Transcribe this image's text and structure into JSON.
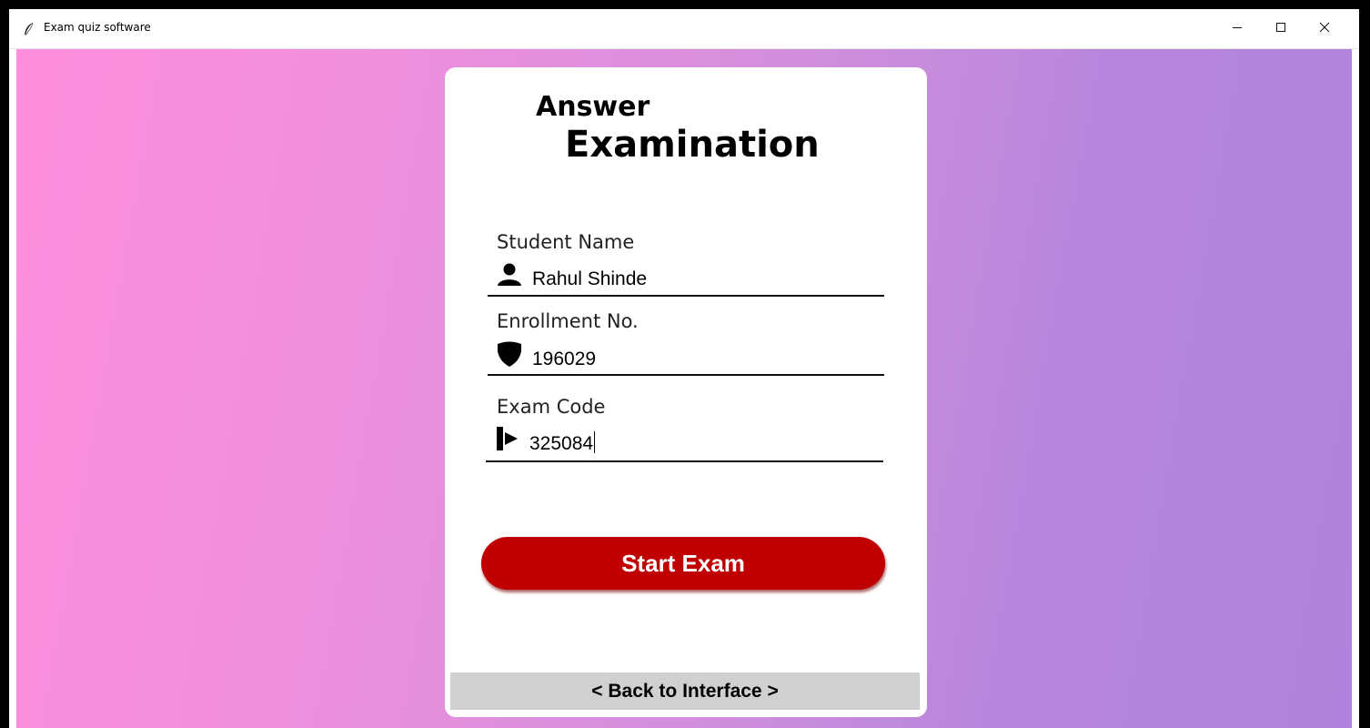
{
  "window": {
    "title": "Exam quiz software",
    "app_icon": "feather-icon",
    "controls": {
      "minimize_icon": "minimize-icon",
      "maximize_icon": "maximize-icon",
      "close_icon": "close-icon"
    }
  },
  "form": {
    "title_line1": "Answer",
    "title_line2": "Examination",
    "fields": [
      {
        "label": "Student Name",
        "value": "Rahul Shinde",
        "icon": "user-icon"
      },
      {
        "label": "Enrollment No.",
        "value": "196029",
        "icon": "shield-icon"
      },
      {
        "label": "Exam Code",
        "value": "325084",
        "icon": "sign-in-icon"
      }
    ],
    "start_button_label": "Start Exam",
    "back_label": "< Back to Interface >"
  },
  "colors": {
    "gradient_start": "#ff8fdd",
    "gradient_end": "#b084dc",
    "start_button": "#c00000",
    "back_bar": "#d0d0d0",
    "card": "#ffffff"
  }
}
